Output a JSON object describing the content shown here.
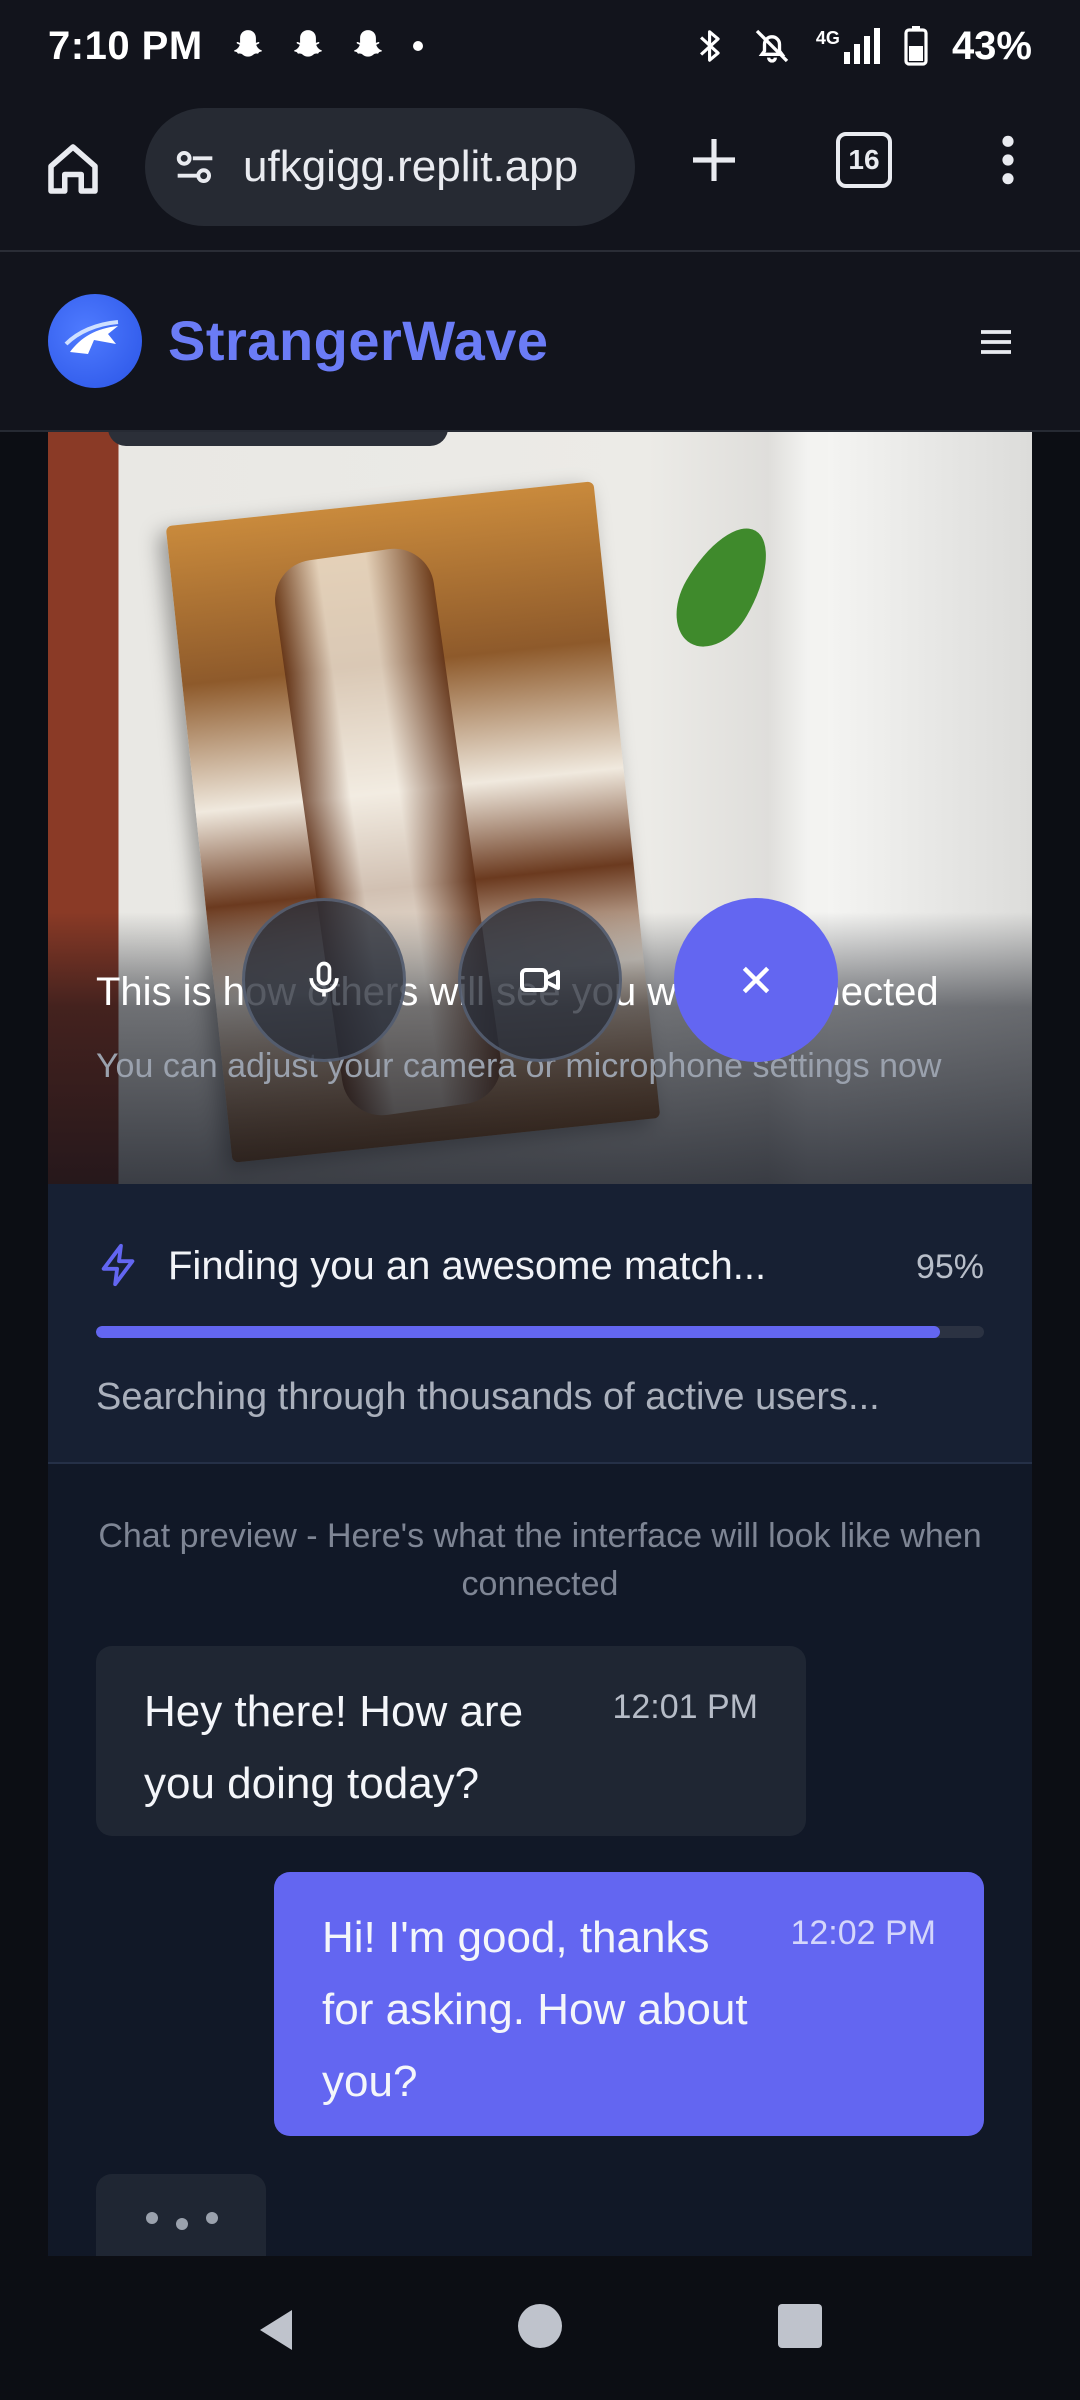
{
  "status_bar": {
    "time": "7:10 PM",
    "battery": "43%",
    "network": "4G",
    "notification_icons": [
      "snapchat-icon",
      "snapchat-icon",
      "snapchat-icon"
    ]
  },
  "browser": {
    "url": "ufkgigg.replit.app",
    "tab_count": "16"
  },
  "app": {
    "brand": "StrangerWave",
    "accent_color": "#6366f1"
  },
  "camera_preview": {
    "title": "This is how others will see you when connected",
    "subtitle": "You can adjust your camera or microphone settings now"
  },
  "matching": {
    "status": "Finding you an awesome match...",
    "percent_label": "95%",
    "progress": 0.95,
    "detail": "Searching through thousands of active users..."
  },
  "chat": {
    "note": "Chat preview - Here's what the interface will look like when connected",
    "messages": [
      {
        "text": "Hey there! How are you doing today?",
        "time": "12:01 PM",
        "direction": "incoming"
      },
      {
        "text": "Hi! I'm good, thanks for asking. How about you?",
        "time": "12:02 PM",
        "direction": "outgoing"
      }
    ]
  }
}
